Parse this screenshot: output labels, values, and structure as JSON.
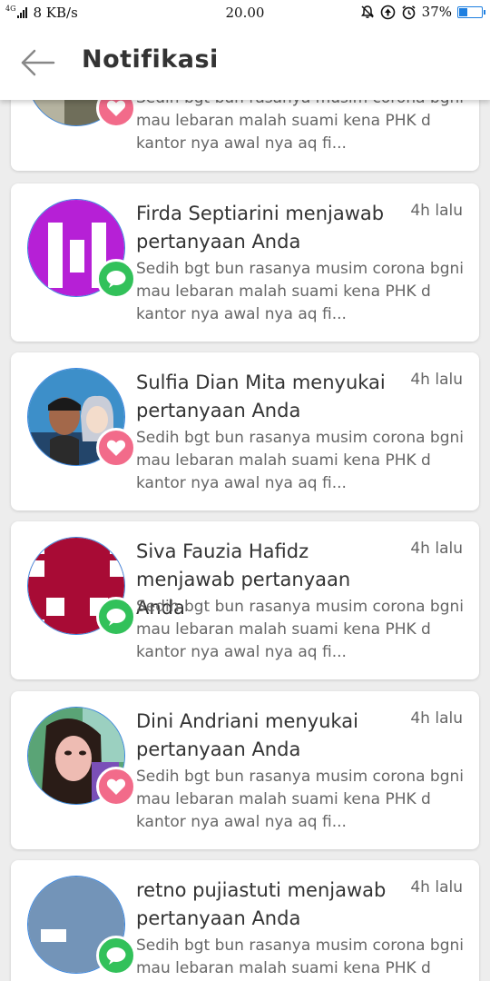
{
  "status_bar": {
    "network": "4G",
    "speed": "8 KB/s",
    "time": "20.00",
    "battery": "37%"
  },
  "header": {
    "title": "Notifikasi",
    "back_icon": "arrow-left-icon"
  },
  "notifications": [
    {
      "title": "",
      "time": "",
      "badge": "heart-icon",
      "snippet": [
        "Sedih bgt bun rasanya musim corona bgni",
        "mau lebaran malah suami kena PHK d",
        "kantor nya awal nya aq fi..."
      ]
    },
    {
      "title": "Firda Septiarini menjawab pertanyaan Anda",
      "time": "4h lalu",
      "badge": "chat-bubble-icon",
      "snippet": [
        " Sedih bgt bun rasanya musim corona bgni",
        "mau lebaran malah suami kena PHK d",
        "kantor nya awal nya aq fi..."
      ]
    },
    {
      "title": "Sulfia Dian Mita menyukai pertanyaan Anda",
      "time": "4h lalu",
      "badge": "heart-icon",
      "snippet": [
        "Sedih bgt bun rasanya musim corona bgni",
        "mau lebaran malah suami kena PHK d",
        "kantor nya awal nya aq fi..."
      ]
    },
    {
      "title": "Siva Fauzia Hafidz menjawab pertanyaan Anda",
      "time": "4h lalu",
      "badge": "chat-bubble-icon",
      "snippet": [
        " Sedih bgt bun rasanya musim corona bgni",
        "mau lebaran malah suami kena PHK d",
        "kantor nya awal nya aq fi..."
      ]
    },
    {
      "title": "Dini Andriani menyukai pertanyaan Anda",
      "time": "4h lalu",
      "badge": "heart-icon",
      "snippet": [
        "Sedih bgt bun rasanya musim corona bgni",
        "mau lebaran malah suami kena PHK d",
        "kantor nya awal nya aq fi..."
      ]
    },
    {
      "title": "retno pujiastuti menjawab pertanyaan Anda",
      "time": "4h lalu",
      "badge": "chat-bubble-icon",
      "snippet": [
        " Sedih bgt bun rasanya musim corona bgni",
        "mau lebaran malah suami kena PHK d",
        ""
      ]
    }
  ],
  "colors": {
    "like_badge": "#f26b8a",
    "answer_badge": "#32c15a",
    "avatar_border": "#3b87e0",
    "battery": "#1e7fe0"
  }
}
